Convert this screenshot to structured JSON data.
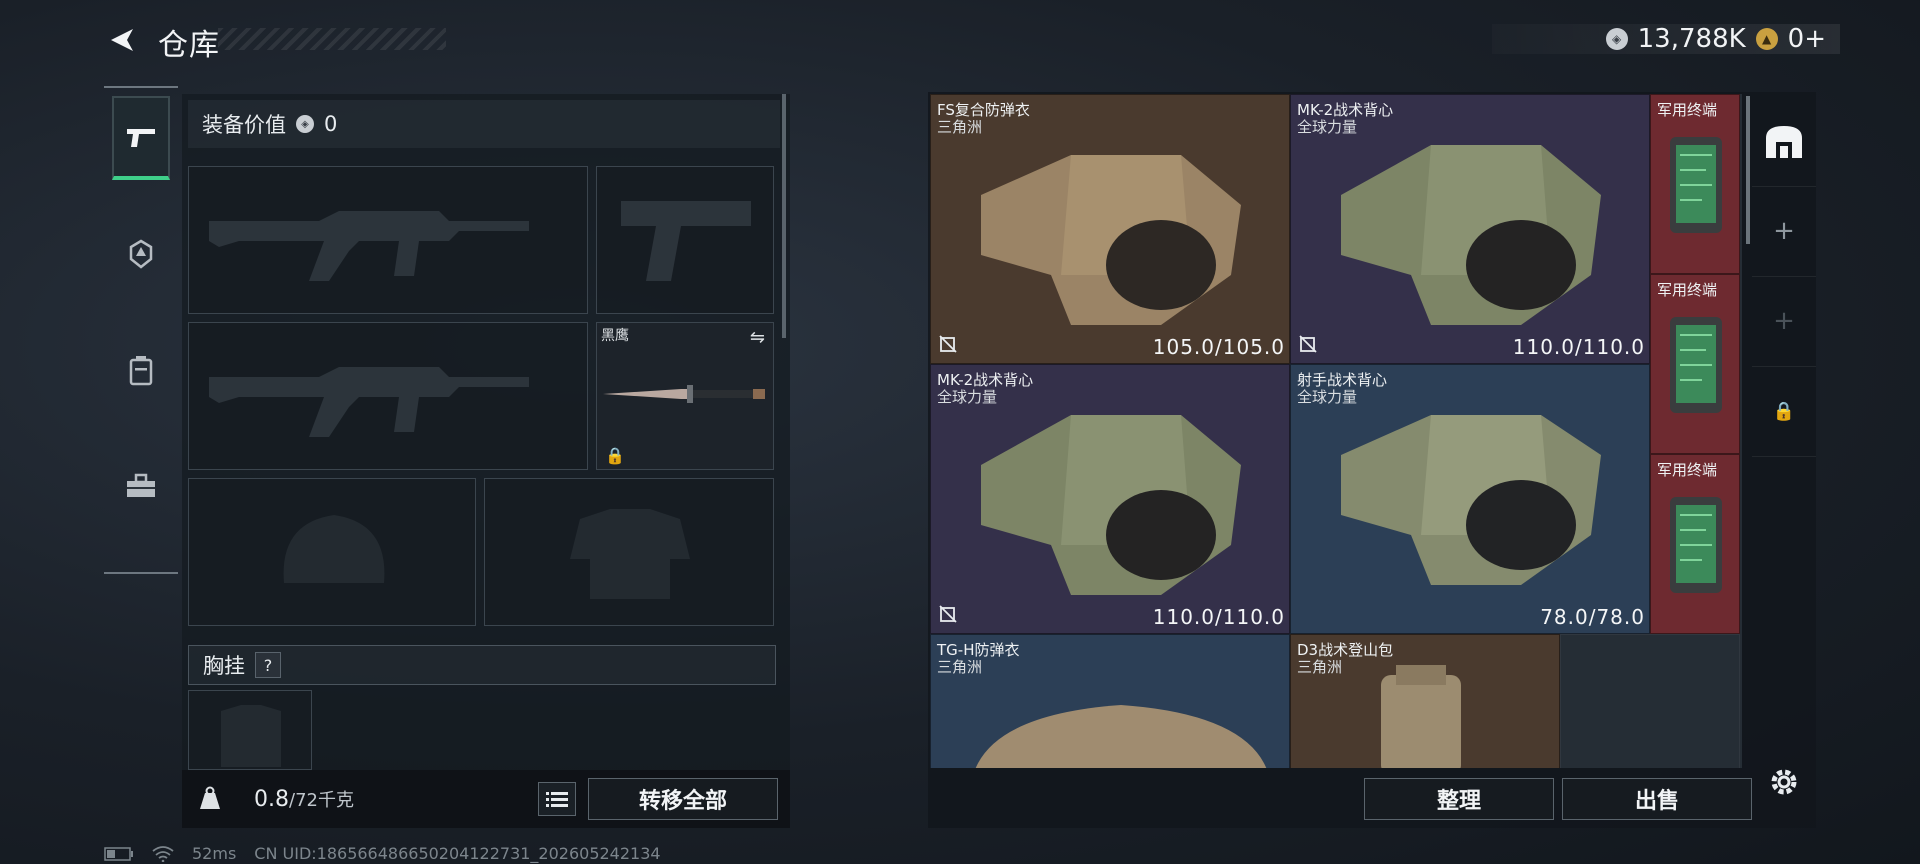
{
  "header": {
    "title": "仓库"
  },
  "currency": {
    "silver": "13,788K",
    "gold": "0+"
  },
  "equipment": {
    "value_label": "装备价值",
    "value": "0",
    "melee_name": "黑鹰",
    "chest_label": "胸挂",
    "chest_help": "?"
  },
  "inventory": {
    "weight_current": "0.8",
    "weight_max": "/72千克",
    "transfer_all": "转移全部",
    "sort": "整理",
    "sell": "出售"
  },
  "items": [
    {
      "name": "FS复合防弹衣",
      "brand": "三角洲",
      "durability": "105.0/105.0",
      "bg": "#4a3a2e"
    },
    {
      "name": "MK-2战术背心",
      "brand": "全球力量",
      "durability": "110.0/110.0",
      "bg": "#34304a"
    },
    {
      "name": "军用终端",
      "brand": "",
      "durability": "",
      "bg": "#6e2a30"
    },
    {
      "name": "MK-2战术背心",
      "brand": "全球力量",
      "durability": "110.0/110.0",
      "bg": "#34304a"
    },
    {
      "name": "射手战术背心",
      "brand": "全球力量",
      "durability": "78.0/78.0",
      "bg": "#2c3f56"
    },
    {
      "name": "军用终端",
      "brand": "",
      "durability": "",
      "bg": "#6e2a30"
    },
    {
      "name": "军用终端",
      "brand": "",
      "durability": "",
      "bg": "#6e2a30"
    },
    {
      "name": "TG-H防弹衣",
      "brand": "三角洲",
      "durability": "",
      "bg": "#2c3f56"
    },
    {
      "name": "D3战术登山包",
      "brand": "三角洲",
      "durability": "",
      "bg": "#4a3a2e"
    }
  ],
  "status": {
    "ping": "52ms",
    "uid": "CN UID:186566486650204122731_202605242134"
  }
}
